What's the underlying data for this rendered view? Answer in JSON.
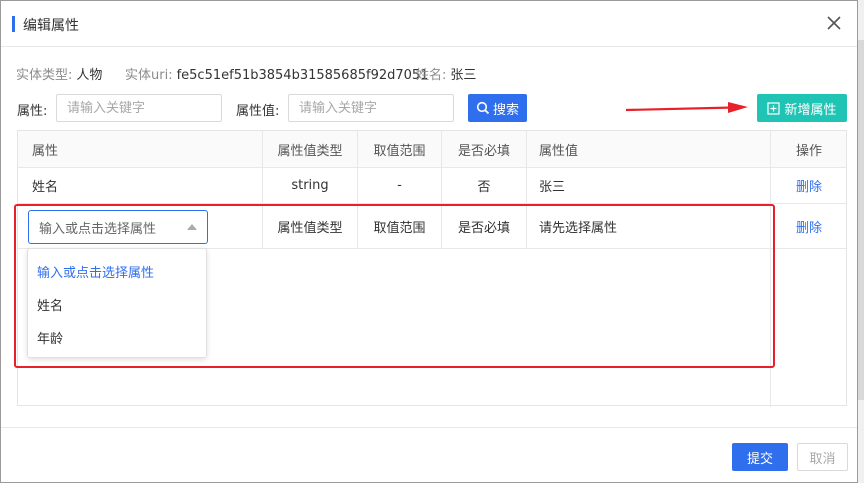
{
  "dialog": {
    "title": "编辑属性",
    "close_icon": "close-icon"
  },
  "entity_info": {
    "type_label": "实体类型:",
    "type_value": "人物",
    "uri_label": "实体uri:",
    "uri_value": "fe5c51ef51b3854b31585685f92d7051",
    "name_label": "姓名:",
    "name_value": "张三"
  },
  "search": {
    "attr_label": "属性:",
    "attr_placeholder": "请输入关键字",
    "value_label": "属性值:",
    "value_placeholder": "请输入关键字",
    "search_button": "搜索",
    "add_button": "新增属性"
  },
  "table": {
    "headers": [
      "属性",
      "属性值类型",
      "取值范围",
      "是否必填",
      "属性值",
      "操作"
    ],
    "rows": [
      {
        "attr": "姓名",
        "type": "string",
        "range": "-",
        "required": "否",
        "value": "张三",
        "action": "删除"
      }
    ],
    "new_row": {
      "select_placeholder": "输入或点击选择属性",
      "type": "属性值类型",
      "range": "取值范围",
      "required": "是否必填",
      "value": "请先选择属性",
      "action": "删除"
    }
  },
  "dropdown": {
    "options": [
      "输入或点击选择属性",
      "姓名",
      "年龄"
    ]
  },
  "footer": {
    "submit": "提交",
    "cancel": "取消"
  },
  "colors": {
    "primary": "#2f6fed",
    "add_button": "#20c4b5",
    "highlight": "#e8202a"
  }
}
